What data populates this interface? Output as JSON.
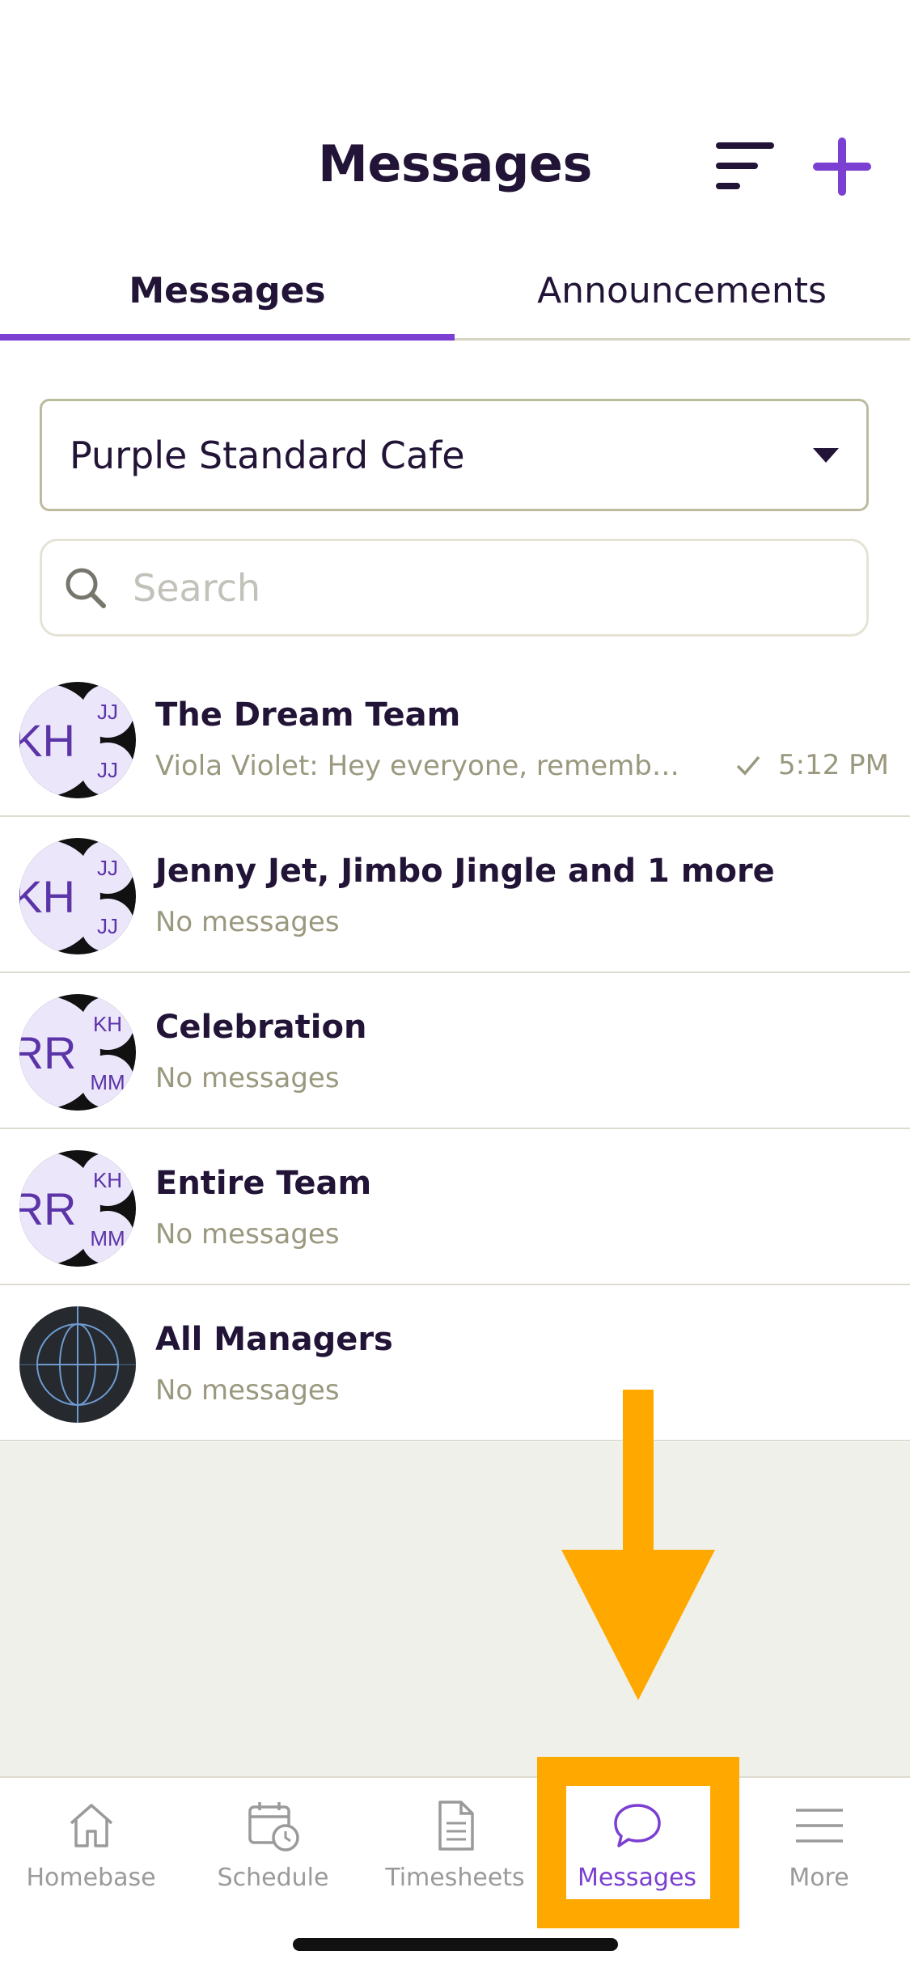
{
  "header": {
    "title": "Messages"
  },
  "tabs": [
    {
      "label": "Messages",
      "active": true
    },
    {
      "label": "Announcements",
      "active": false
    }
  ],
  "location": {
    "selected": "Purple Standard Cafe"
  },
  "search": {
    "placeholder": "Search"
  },
  "conversations": [
    {
      "name": "The Dream Team",
      "preview": "Viola Violet: Hey everyone, remember t...",
      "time": "5:12 PM",
      "avatar": {
        "main": "KH",
        "top": "JJ",
        "bottom": "JJ"
      }
    },
    {
      "name": "Jenny Jet, Jimbo Jingle and 1 more",
      "preview": "No messages",
      "time": "",
      "avatar": {
        "main": "KH",
        "top": "JJ",
        "bottom": "JJ"
      }
    },
    {
      "name": "Celebration",
      "preview": "No messages",
      "time": "",
      "avatar": {
        "main": "RR",
        "top": "KH",
        "bottom": "MM"
      }
    },
    {
      "name": "Entire Team",
      "preview": "No messages",
      "time": "",
      "avatar": {
        "main": "RR",
        "top": "KH",
        "bottom": "MM"
      }
    },
    {
      "name": "All Managers",
      "preview": "No messages",
      "time": "",
      "avatar": {
        "main": "",
        "top": "",
        "bottom": ""
      }
    }
  ],
  "bottom_nav": [
    {
      "label": "Homebase",
      "icon": "home-icon",
      "active": false
    },
    {
      "label": "Schedule",
      "icon": "calendar-clock-icon",
      "active": false
    },
    {
      "label": "Timesheets",
      "icon": "document-icon",
      "active": false
    },
    {
      "label": "Messages",
      "icon": "chat-bubble-icon",
      "active": true
    },
    {
      "label": "More",
      "icon": "menu-icon",
      "active": false
    }
  ],
  "colors": {
    "accent": "#7b3fd1",
    "text_dark": "#221437",
    "muted": "#9a987e",
    "annotation": "#ffa800",
    "empty_bg": "#f0f0ea"
  }
}
